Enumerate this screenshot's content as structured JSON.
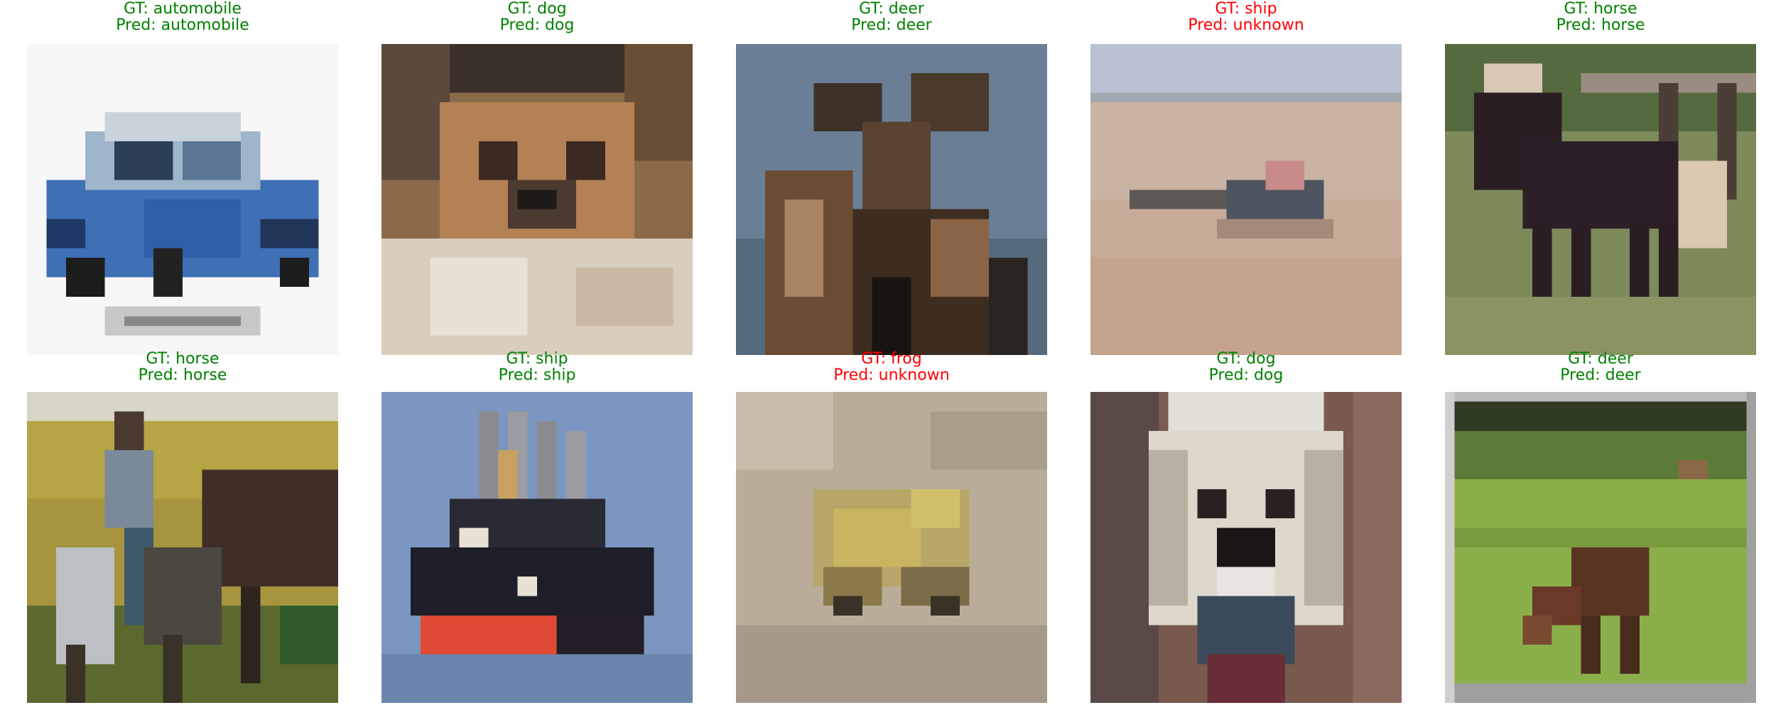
{
  "colors": {
    "correct": "#008000",
    "incorrect": "#ff0000"
  },
  "items": [
    {
      "gt": "GT: automobile",
      "pred": "Pred: automobile",
      "status": "correct",
      "icon": "car-image-icon"
    },
    {
      "gt": "GT: dog",
      "pred": "Pred: dog",
      "status": "correct",
      "icon": "dog-face-image-icon"
    },
    {
      "gt": "GT: deer",
      "pred": "Pred: deer",
      "status": "correct",
      "icon": "moose-image-icon"
    },
    {
      "gt": "GT: ship",
      "pred": "Pred: unknown",
      "status": "incorrect",
      "icon": "ship-on-water-image-icon"
    },
    {
      "gt": "GT: horse",
      "pred": "Pred: horse",
      "status": "correct",
      "icon": "dark-horse-image-icon"
    },
    {
      "gt": "GT: horse",
      "pred": "Pred: horse",
      "status": "correct",
      "icon": "rider-horse-image-icon"
    },
    {
      "gt": "GT: ship",
      "pred": "Pred: ship",
      "status": "correct",
      "icon": "red-hull-ship-image-icon"
    },
    {
      "gt": "GT: frog",
      "pred": "Pred: unknown",
      "status": "incorrect",
      "icon": "frog-image-icon"
    },
    {
      "gt": "GT: dog",
      "pred": "Pred: dog",
      "status": "correct",
      "icon": "white-dog-image-icon"
    },
    {
      "gt": "GT: deer",
      "pred": "Pred: deer",
      "status": "correct",
      "icon": "deer-grazing-image-icon"
    }
  ]
}
